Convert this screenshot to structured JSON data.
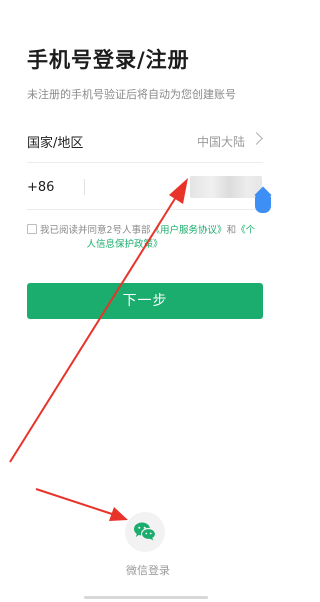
{
  "header": {
    "title": "手机号登录/注册",
    "subtitle": "未注册的手机号验证后将自动为您创建账号"
  },
  "region_row": {
    "label": "国家/地区",
    "value": "中国大陆"
  },
  "phone_row": {
    "code": "+86",
    "value": ""
  },
  "agreement": {
    "prefix": "我已阅读并同意2号人事部",
    "user_agreement": "《用户服务协议》",
    "and": "和",
    "privacy_part1": "《个",
    "privacy_part2": "人信息保护政策》"
  },
  "next_button": {
    "label": "下一步"
  },
  "wechat_login": {
    "label": "微信登录"
  },
  "colors": {
    "primary": "#1aad6d",
    "annotation": "#e8332a",
    "handle": "#3d8ff5"
  }
}
